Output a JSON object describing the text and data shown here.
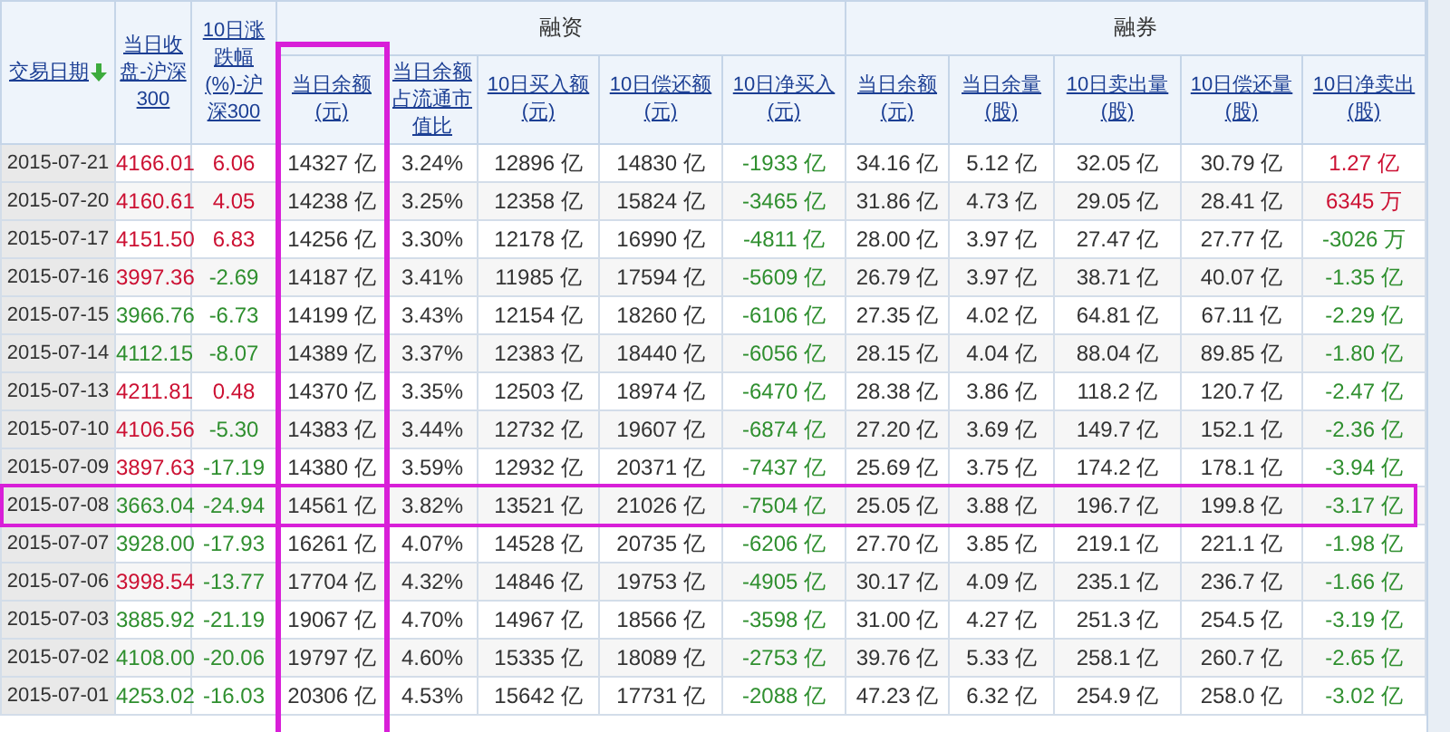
{
  "columns": [
    {
      "label": "交易日期",
      "sorted": true
    },
    {
      "label": "当日收盘-沪深300"
    },
    {
      "label": "10日涨跌幅(%)-沪深300"
    },
    {
      "group": "融资",
      "columns": [
        {
          "label": "当日余额(元)",
          "highlighted": true
        },
        {
          "label": "当日余额占流通市值比",
          "highlighted": false
        },
        {
          "label": "10日买入额(元)",
          "highlighted": false
        },
        {
          "label": "10日偿还额(元)",
          "highlighted": false
        },
        {
          "label": "10日净买入(元)",
          "highlighted": false
        }
      ]
    },
    {
      "group": "融券",
      "columns": [
        {
          "label": "当日余额(元)",
          "highlighted": false
        },
        {
          "label": "当日余量(股)",
          "highlighted": false
        },
        {
          "label": "10日卖出量(股)",
          "highlighted": false
        },
        {
          "label": "10日偿还量(股)",
          "highlighted": false
        },
        {
          "label": "10日净卖出(股)",
          "highlighted": false
        }
      ]
    }
  ],
  "rows": [
    {
      "highlighted": false,
      "cells": [
        "2015-07-21",
        {
          "text": "4166.01",
          "color": "#cc1133"
        },
        {
          "text": "6.06",
          "color": "#cc1133"
        },
        "14327 亿",
        "3.24%",
        "12896 亿",
        "14830 亿",
        {
          "text": "-1933 亿",
          "color": "#2f8f2f"
        },
        "34.16 亿",
        "5.12 亿",
        "32.05 亿",
        "30.79 亿",
        {
          "text": "1.27 亿",
          "color": "#cc1133"
        }
      ]
    },
    {
      "highlighted": false,
      "cells": [
        "2015-07-20",
        {
          "text": "4160.61",
          "color": "#cc1133"
        },
        {
          "text": "4.05",
          "color": "#cc1133"
        },
        "14238 亿",
        "3.25%",
        "12358 亿",
        "15824 亿",
        {
          "text": "-3465 亿",
          "color": "#2f8f2f"
        },
        "31.86 亿",
        "4.73 亿",
        "29.05 亿",
        "28.41 亿",
        {
          "text": "6345 万",
          "color": "#cc1133"
        }
      ]
    },
    {
      "highlighted": false,
      "cells": [
        "2015-07-17",
        {
          "text": "4151.50",
          "color": "#cc1133"
        },
        {
          "text": "6.83",
          "color": "#cc1133"
        },
        "14256 亿",
        "3.30%",
        "12178 亿",
        "16990 亿",
        {
          "text": "-4811 亿",
          "color": "#2f8f2f"
        },
        "28.00 亿",
        "3.97 亿",
        "27.47 亿",
        "27.77 亿",
        {
          "text": "-3026 万",
          "color": "#2f8f2f"
        }
      ]
    },
    {
      "highlighted": false,
      "cells": [
        "2015-07-16",
        {
          "text": "3997.36",
          "color": "#cc1133"
        },
        {
          "text": "-2.69",
          "color": "#2f8f2f"
        },
        "14187 亿",
        "3.41%",
        "11985 亿",
        "17594 亿",
        {
          "text": "-5609 亿",
          "color": "#2f8f2f"
        },
        "26.79 亿",
        "3.97 亿",
        "38.71 亿",
        "40.07 亿",
        {
          "text": "-1.35 亿",
          "color": "#2f8f2f"
        }
      ]
    },
    {
      "highlighted": false,
      "cells": [
        "2015-07-15",
        {
          "text": "3966.76",
          "color": "#2f8f2f"
        },
        {
          "text": "-6.73",
          "color": "#2f8f2f"
        },
        "14199 亿",
        "3.43%",
        "12154 亿",
        "18260 亿",
        {
          "text": "-6106 亿",
          "color": "#2f8f2f"
        },
        "27.35 亿",
        "4.02 亿",
        "64.81 亿",
        "67.11 亿",
        {
          "text": "-2.29 亿",
          "color": "#2f8f2f"
        }
      ]
    },
    {
      "highlighted": false,
      "cells": [
        "2015-07-14",
        {
          "text": "4112.15",
          "color": "#2f8f2f"
        },
        {
          "text": "-8.07",
          "color": "#2f8f2f"
        },
        "14389 亿",
        "3.37%",
        "12383 亿",
        "18440 亿",
        {
          "text": "-6056 亿",
          "color": "#2f8f2f"
        },
        "28.15 亿",
        "4.04 亿",
        "88.04 亿",
        "89.85 亿",
        {
          "text": "-1.80 亿",
          "color": "#2f8f2f"
        }
      ]
    },
    {
      "highlighted": false,
      "cells": [
        "2015-07-13",
        {
          "text": "4211.81",
          "color": "#cc1133"
        },
        {
          "text": "0.48",
          "color": "#cc1133"
        },
        "14370 亿",
        "3.35%",
        "12503 亿",
        "18974 亿",
        {
          "text": "-6470 亿",
          "color": "#2f8f2f"
        },
        "28.38 亿",
        "3.86 亿",
        "118.2 亿",
        "120.7 亿",
        {
          "text": "-2.47 亿",
          "color": "#2f8f2f"
        }
      ]
    },
    {
      "highlighted": false,
      "cells": [
        "2015-07-10",
        {
          "text": "4106.56",
          "color": "#cc1133"
        },
        {
          "text": "-5.30",
          "color": "#2f8f2f"
        },
        "14383 亿",
        "3.44%",
        "12732 亿",
        "19607 亿",
        {
          "text": "-6874 亿",
          "color": "#2f8f2f"
        },
        "27.20 亿",
        "3.69 亿",
        "149.7 亿",
        "152.1 亿",
        {
          "text": "-2.36 亿",
          "color": "#2f8f2f"
        }
      ]
    },
    {
      "highlighted": false,
      "cells": [
        "2015-07-09",
        {
          "text": "3897.63",
          "color": "#cc1133"
        },
        {
          "text": "-17.19",
          "color": "#2f8f2f"
        },
        "14380 亿",
        "3.59%",
        "12932 亿",
        "20371 亿",
        {
          "text": "-7437 亿",
          "color": "#2f8f2f"
        },
        "25.69 亿",
        "3.75 亿",
        "174.2 亿",
        "178.1 亿",
        {
          "text": "-3.94 亿",
          "color": "#2f8f2f"
        }
      ]
    },
    {
      "highlighted": true,
      "cells": [
        "2015-07-08",
        {
          "text": "3663.04",
          "color": "#2f8f2f"
        },
        {
          "text": "-24.94",
          "color": "#2f8f2f"
        },
        "14561 亿",
        "3.82%",
        "13521 亿",
        "21026 亿",
        {
          "text": "-7504 亿",
          "color": "#2f8f2f"
        },
        "25.05 亿",
        "3.88 亿",
        "196.7 亿",
        "199.8 亿",
        {
          "text": "-3.17 亿",
          "color": "#2f8f2f"
        }
      ]
    },
    {
      "highlighted": false,
      "cells": [
        "2015-07-07",
        {
          "text": "3928.00",
          "color": "#2f8f2f"
        },
        {
          "text": "-17.93",
          "color": "#2f8f2f"
        },
        "16261 亿",
        "4.07%",
        "14528 亿",
        "20735 亿",
        {
          "text": "-6206 亿",
          "color": "#2f8f2f"
        },
        "27.70 亿",
        "3.85 亿",
        "219.1 亿",
        "221.1 亿",
        {
          "text": "-1.98 亿",
          "color": "#2f8f2f"
        }
      ]
    },
    {
      "highlighted": false,
      "cells": [
        "2015-07-06",
        {
          "text": "3998.54",
          "color": "#cc1133"
        },
        {
          "text": "-13.77",
          "color": "#2f8f2f"
        },
        "17704 亿",
        "4.32%",
        "14846 亿",
        "19753 亿",
        {
          "text": "-4905 亿",
          "color": "#2f8f2f"
        },
        "30.17 亿",
        "4.09 亿",
        "235.1 亿",
        "236.7 亿",
        {
          "text": "-1.66 亿",
          "color": "#2f8f2f"
        }
      ]
    },
    {
      "highlighted": false,
      "cells": [
        "2015-07-03",
        {
          "text": "3885.92",
          "color": "#2f8f2f"
        },
        {
          "text": "-21.19",
          "color": "#2f8f2f"
        },
        "19067 亿",
        "4.70%",
        "14967 亿",
        "18566 亿",
        {
          "text": "-3598 亿",
          "color": "#2f8f2f"
        },
        "31.00 亿",
        "4.27 亿",
        "251.3 亿",
        "254.5 亿",
        {
          "text": "-3.19 亿",
          "color": "#2f8f2f"
        }
      ]
    },
    {
      "highlighted": false,
      "cells": [
        "2015-07-02",
        {
          "text": "4108.00",
          "color": "#2f8f2f"
        },
        {
          "text": "-20.06",
          "color": "#2f8f2f"
        },
        "19797 亿",
        "4.60%",
        "15335 亿",
        "18089 亿",
        {
          "text": "-2753 亿",
          "color": "#2f8f2f"
        },
        "39.76 亿",
        "5.33 亿",
        "258.1 亿",
        "260.7 亿",
        {
          "text": "-2.65 亿",
          "color": "#2f8f2f"
        }
      ]
    },
    {
      "highlighted": false,
      "cells": [
        "2015-07-01",
        {
          "text": "4253.02",
          "color": "#2f8f2f"
        },
        {
          "text": "-16.03",
          "color": "#2f8f2f"
        },
        "20306 亿",
        "4.53%",
        "15642 亿",
        "17731 亿",
        {
          "text": "-2088 亿",
          "color": "#2f8f2f"
        },
        "47.23 亿",
        "6.32 亿",
        "254.9 亿",
        "258.0 亿",
        {
          "text": "-3.02 亿",
          "color": "#2f8f2f"
        }
      ]
    }
  ]
}
